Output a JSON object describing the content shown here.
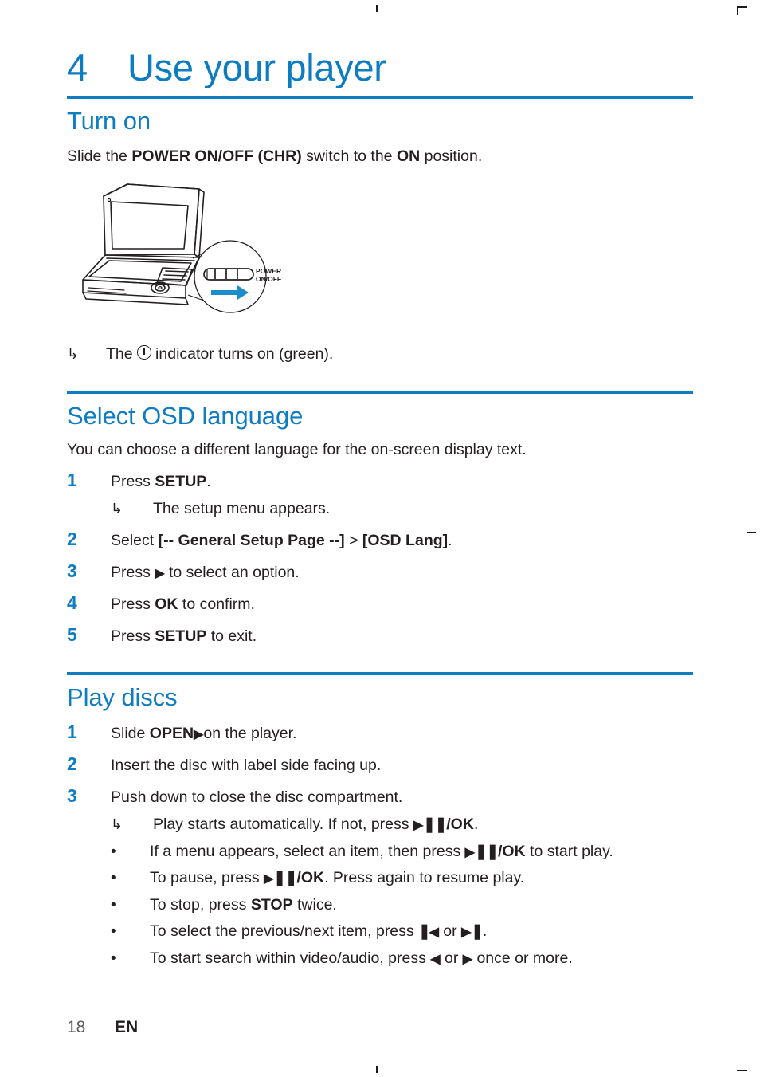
{
  "chapter": {
    "number": "4",
    "title": "Use your player"
  },
  "sections": {
    "turn_on": {
      "heading": "Turn on",
      "intro_parts": {
        "a": "Slide the ",
        "b": "POWER ON/OFF (CHR)",
        "c": " switch to the ",
        "d": "ON",
        "e": " position."
      },
      "illustration": {
        "name": "portable-dvd-player-power-switch-diagram",
        "callout_label_line1": "POWER",
        "callout_label_line2": "ON/OFF",
        "arrow_color": "#1b8ccc",
        "line_color": "#231f20"
      },
      "result_arrow": "↳",
      "result_parts": {
        "a": "The ",
        "b": " indicator turns on (green)."
      }
    },
    "select_osd": {
      "heading": "Select OSD language",
      "intro": "You can choose a different language for the on-screen display text.",
      "steps": [
        {
          "num": "1",
          "parts": {
            "a": "Press ",
            "bold": "SETUP",
            "c": "."
          },
          "result_arrow": "↳",
          "result": "The setup menu appears."
        },
        {
          "num": "2",
          "parts": {
            "a": "Select ",
            "bold": "[-- General Setup Page --]",
            "c": " > ",
            "bold2": "[OSD Lang]",
            "d": "."
          }
        },
        {
          "num": "3",
          "parts": {
            "a": "Press ",
            "glyph": "play-right-arrow",
            "c": " to select an option."
          }
        },
        {
          "num": "4",
          "parts": {
            "a": "Press ",
            "bold": "OK",
            "c": " to confirm."
          }
        },
        {
          "num": "5",
          "parts": {
            "a": "Press ",
            "bold": "SETUP",
            "c": " to exit."
          }
        }
      ]
    },
    "play_discs": {
      "heading": "Play discs",
      "steps": [
        {
          "num": "1",
          "parts": {
            "a": "Slide ",
            "bold": "OPEN",
            "glyph": "play-right-arrow",
            "c": "on the player."
          }
        },
        {
          "num": "2",
          "parts": {
            "a": "Insert the disc with label side facing up."
          }
        },
        {
          "num": "3",
          "parts": {
            "a": "Push down to close the disc compartment."
          }
        }
      ],
      "result_arrow": "↳",
      "result_parts": {
        "a": "Play starts automatically. If not, press ",
        "glyph": "play-pause-ok",
        "b": "/OK",
        "c": "."
      },
      "bullet_char": "•",
      "bullets": [
        {
          "a": "If a menu appears, select an item, then press ",
          "glyph": "play-pause-ok",
          "b": "/OK",
          "c": " to start play."
        },
        {
          "a": "To pause, press ",
          "glyph": "play-pause-ok",
          "b": "/OK",
          "c": ". Press again to resume play."
        },
        {
          "a": "To stop, press ",
          "bold": "STOP",
          "c": " twice."
        },
        {
          "a": "To select the previous/next item, press ",
          "glyph": "previous",
          "b": " or ",
          "glyph2": "next",
          "c": "."
        },
        {
          "a": "To start search within video/audio, press ",
          "glyph": "rewind-left",
          "b": " or ",
          "glyph2": "forward-right",
          "c": " once or more."
        }
      ]
    }
  },
  "footer": {
    "page_number": "18",
    "language_code": "EN"
  },
  "colors": {
    "accent_blue": "#0d7cc0",
    "body_text": "#231f20",
    "arrow_blue": "#1b8ccc"
  }
}
